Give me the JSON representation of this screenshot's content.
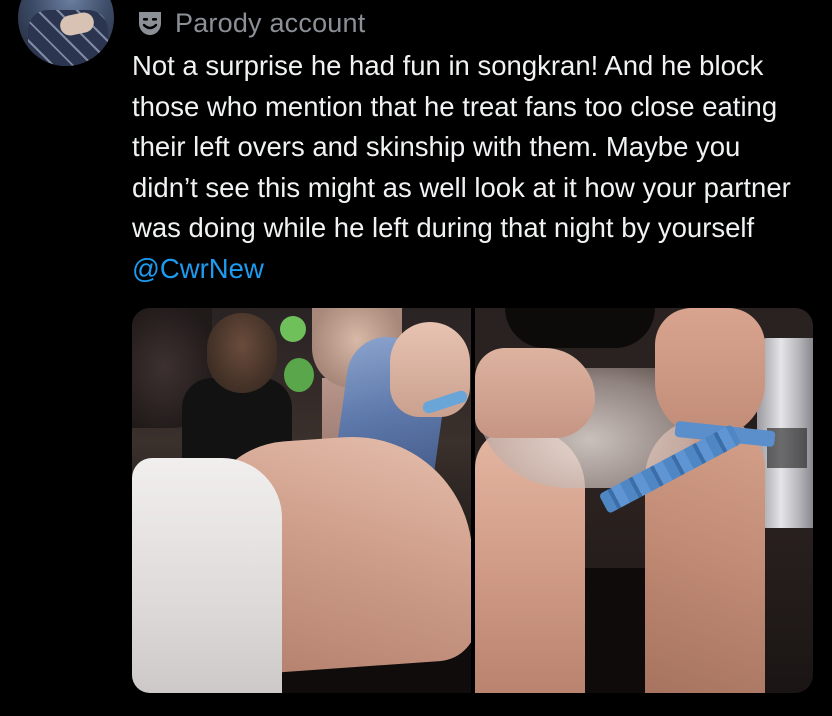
{
  "tweet": {
    "account_label": "Parody account",
    "badge_icon": "parody-mask-icon",
    "text": "Not a surprise he had fun in songkran! And he block those who mention that he treat fans too close eating their left overs and skinship with them. Maybe you didn’t see this might as well look at it how your partner was doing while he left during that night by yourself ",
    "mention": "@CwrNew"
  },
  "media": {
    "photos": [
      {
        "icon": "photo-crowd-cap"
      },
      {
        "icon": "photo-bowl-wristband"
      }
    ]
  },
  "colors": {
    "background": "#000000",
    "text": "#f0f2f3",
    "muted": "#8b9097",
    "link": "#1d9bf0"
  }
}
